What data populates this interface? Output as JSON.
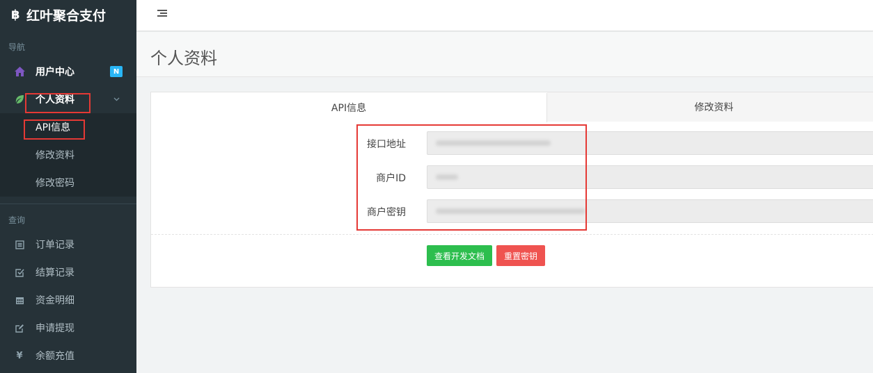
{
  "app": {
    "name": "红叶聚合支付",
    "logo_glyph": "฿"
  },
  "sidebar": {
    "nav_section": "导航",
    "user_center": {
      "label": "用户中心",
      "badge": "N"
    },
    "profile_group": {
      "label": "个人资料",
      "children": [
        {
          "label": "API信息"
        },
        {
          "label": "修改资料"
        },
        {
          "label": "修改密码"
        }
      ]
    },
    "query_section": "查询",
    "query_items": [
      {
        "label": "订单记录",
        "icon": "list-icon"
      },
      {
        "label": "结算记录",
        "icon": "check-square-icon"
      },
      {
        "label": "资金明细",
        "icon": "calendar-icon"
      },
      {
        "label": "申请提现",
        "icon": "edit-icon"
      },
      {
        "label": "余额充值",
        "icon": "yen-icon"
      }
    ]
  },
  "header": {
    "page_title": "个人资料"
  },
  "tabs": [
    {
      "label": "API信息"
    },
    {
      "label": "修改资料"
    }
  ],
  "form": {
    "fields": [
      {
        "label": "接口地址",
        "value": ""
      },
      {
        "label": "商户ID",
        "value": ""
      },
      {
        "label": "商户密钥",
        "value": ""
      }
    ]
  },
  "buttons": {
    "docs": "查看开发文档",
    "reset_key": "重置密钥"
  },
  "colors": {
    "sidebar_bg": "#263238",
    "accent_green": "#2dbe4e",
    "accent_red": "#ef5350",
    "badge_blue": "#29b6f6",
    "highlight_red": "#e53935"
  }
}
